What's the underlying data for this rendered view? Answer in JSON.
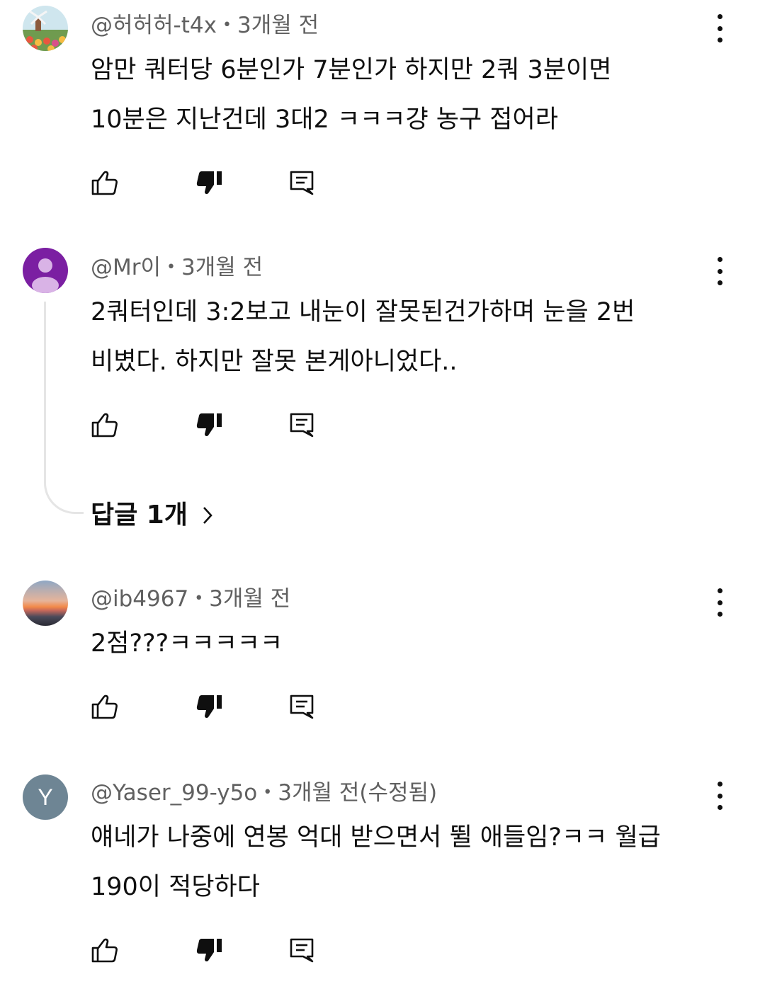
{
  "comments": [
    {
      "author": "@허허허-t4x",
      "time": "3개월 전",
      "lines": [
        "암만 쿼터당 6분인가 7분인가 하지만 2쿼 3분이면",
        "10분은 지난건데 3대2 ㅋㅋㅋ걍 농구 접어라"
      ]
    },
    {
      "author": "@Mr이",
      "time": "3개월 전",
      "lines": [
        "2쿼터인데 3:2보고 내눈이 잘못된건가하며 눈을 2번",
        "비볐다. 하지만 잘못 본게아니었다.."
      ],
      "replies_label": "답글 1개"
    },
    {
      "author": "@ib4967",
      "time": "3개월 전",
      "lines": [
        "2점???ㅋㅋㅋㅋㅋ"
      ]
    },
    {
      "author": "@Yaser_99-y5o",
      "time": "3개월 전(수정됨)",
      "avatar_letter": "Y",
      "lines": [
        "얘네가 나중에 연봉 억대 받으면서 뛸 애들임?ㅋㅋ 월급",
        "190이 적당하다"
      ]
    }
  ],
  "separator": "•",
  "colors": {
    "text": "#0f0f0f",
    "meta": "#606060",
    "thread_line": "#e5e5e5",
    "avatar_y": "#6e8594",
    "avatar_default": "#7b1fa2"
  },
  "icons": [
    "like-icon",
    "dislike-icon",
    "reply-icon",
    "more-icon",
    "chevron-right-icon"
  ]
}
